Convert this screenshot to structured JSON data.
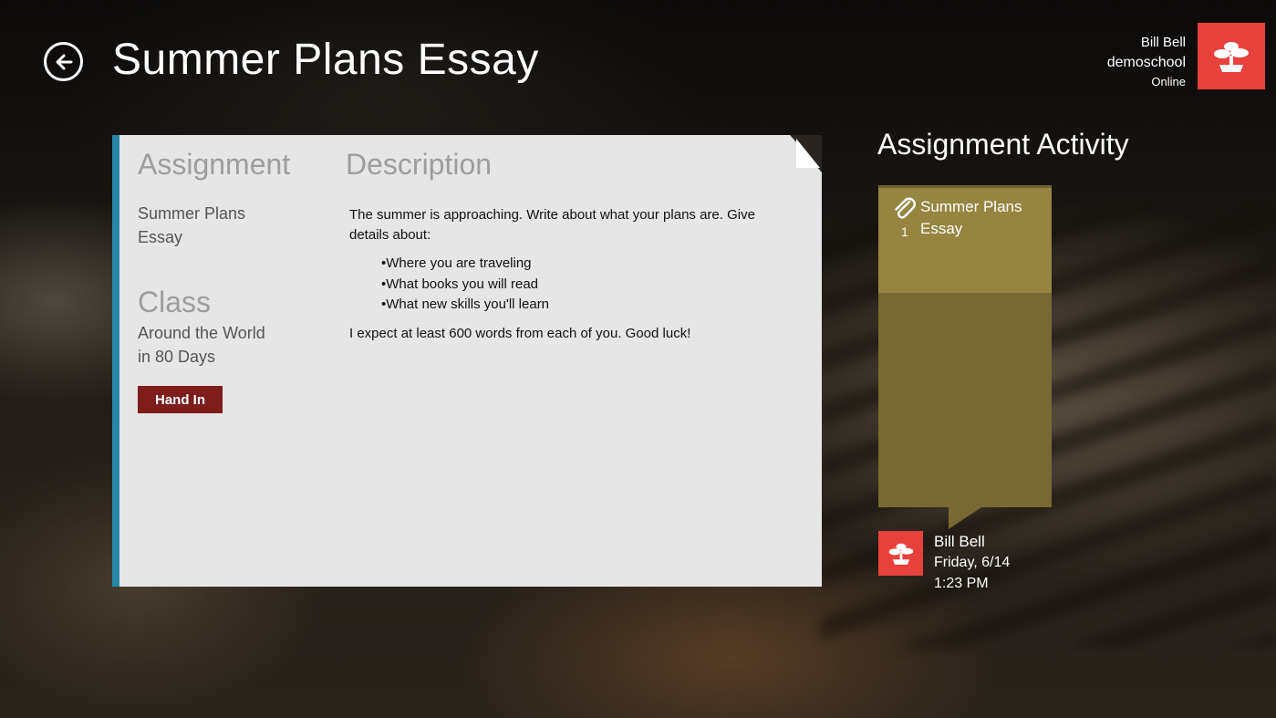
{
  "header": {
    "title": "Summer Plans Essay",
    "back_icon": "back-arrow-icon"
  },
  "user": {
    "name": "Bill Bell",
    "school": "demoschool",
    "status": "Online",
    "avatar_icon": "bonsai-tree-icon",
    "avatar_color": "#e8413b"
  },
  "card": {
    "accent_color": "#2a86a7",
    "assignment_heading": "Assignment",
    "assignment_name_line1": "Summer Plans",
    "assignment_name_line2": "Essay",
    "class_heading": "Class",
    "class_name_line1": "Around the World",
    "class_name_line2": "in 80 Days",
    "hand_in_label": "Hand In",
    "hand_in_color": "#7f1d1d",
    "description_heading": "Description",
    "description_intro": "The summer is approaching. Write about what your plans are. Give details about:",
    "description_points": [
      "Where you are traveling",
      "What books you will read",
      "What new skills you'll learn"
    ],
    "description_closing": "I expect at least 600 words from each of you. Good luck!"
  },
  "activity": {
    "title": "Assignment Activity",
    "tile": {
      "name": "Summer Plans Essay",
      "attachment_count": "1",
      "icon": "paperclip-icon",
      "color": "#958540"
    },
    "submission": {
      "author": "Bill Bell",
      "date": "Friday, 6/14",
      "time": "1:23 PM",
      "avatar_icon": "bonsai-tree-icon"
    }
  }
}
